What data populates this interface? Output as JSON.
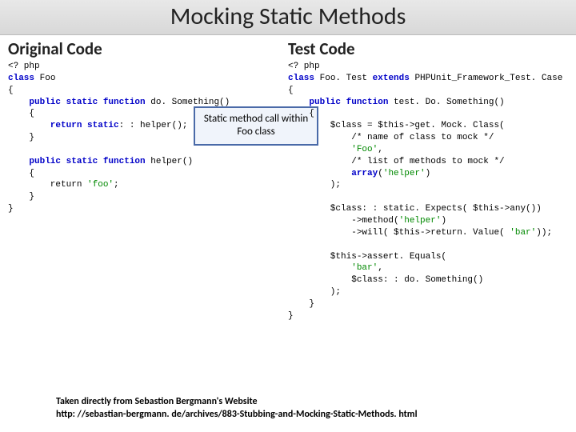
{
  "title": "Mocking Static Methods",
  "left": {
    "heading": "Original Code",
    "callout": "Static method call within Foo class"
  },
  "right": {
    "heading": "Test Code"
  },
  "footer": {
    "line1": "Taken directly from Sebastion Bergmann's Website",
    "line2": "http: //sebastian-bergmann. de/archives/883-Stubbing-and-Mocking-Static-Methods. html"
  },
  "code_left": {
    "l1": "<? php",
    "l2a": "class",
    "l2b": " Foo",
    "l3": "{",
    "l4a": "    public static function",
    "l4b": " do. Something()",
    "l5": "    {",
    "l6a": "        return static",
    "l6b": ": : helper();",
    "l7": "    }",
    "l8": "",
    "l9a": "    public static function",
    "l9b": " helper()",
    "l10": "    {",
    "l11a": "        return ",
    "l11b": "'foo'",
    "l11c": ";",
    "l12": "    }",
    "l13": "}"
  },
  "code_right": {
    "l1": "<? php",
    "l2a": "class",
    "l2b": " Foo. Test ",
    "l2c": "extends",
    "l2d": " PHPUnit_Framework_Test. Case",
    "l3": "{",
    "l4a": "    public function",
    "l4b": " test. Do. Something()",
    "l5": "    {",
    "l6": "        $class = $this->get. Mock. Class(",
    "l7": "            /* name of class to mock */",
    "l8a": "            ",
    "l8b": "'Foo'",
    "l8c": ",",
    "l9": "            /* list of methods to mock */",
    "l10a": "            ",
    "l10b": "array",
    "l10c": "(",
    "l10d": "'helper'",
    "l10e": ")",
    "l11": "        );",
    "l12": "",
    "l13": "        $class: : static. Expects( $this->any())",
    "l14a": "            ->method(",
    "l14b": "'helper'",
    "l14c": ")",
    "l15a": "            ->will( $this->return. Value( ",
    "l15b": "'bar'",
    "l15c": "));",
    "l16": "",
    "l17": "        $this->assert. Equals(",
    "l18a": "            ",
    "l18b": "'bar'",
    "l18c": ",",
    "l19": "            $class: : do. Something()",
    "l20": "        );",
    "l21": "    }",
    "l22": "}"
  }
}
